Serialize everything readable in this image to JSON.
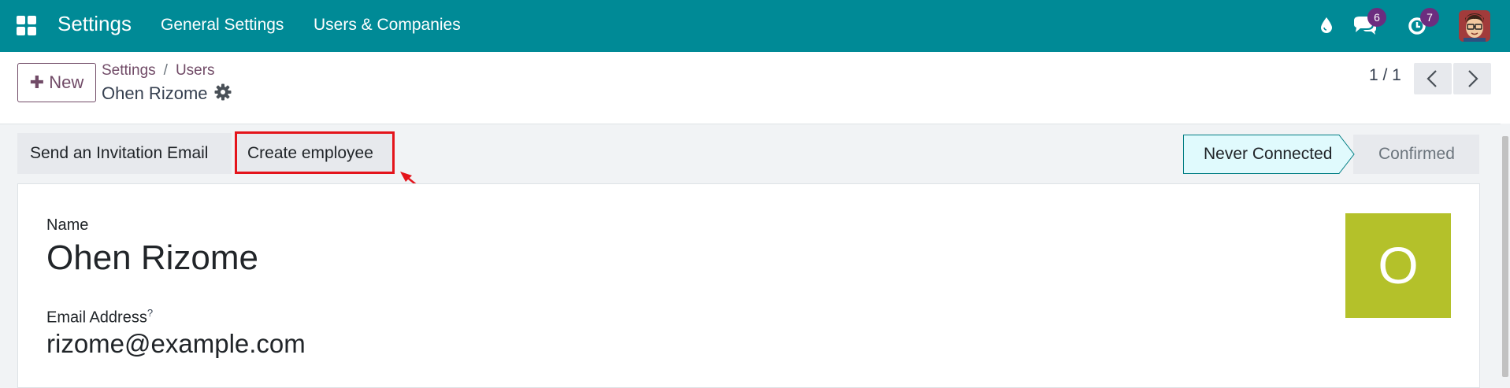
{
  "navbar": {
    "app_title": "Settings",
    "menu": [
      "General Settings",
      "Users & Companies"
    ],
    "icons": {
      "activity": "drop-icon",
      "chat": "chat-icon",
      "clock": "clock-icon"
    },
    "chat_badge": "6",
    "activity_badge": "7",
    "color": "#008a96"
  },
  "control_panel": {
    "new_label": "New",
    "breadcrumb": [
      "Settings",
      "Users"
    ],
    "record_title": "Ohen Rizome",
    "pager": "1 / 1"
  },
  "buttons": {
    "invite": "Send an Invitation Email",
    "create_employee": "Create employee"
  },
  "statusbar": {
    "active": "Never Connected",
    "inactive": "Confirmed"
  },
  "form": {
    "name_label": "Name",
    "name_value": "Ohen Rizome",
    "email_label": "Email Address",
    "email_help": "?",
    "email_value": "rizome@example.com",
    "avatar_letter": "O"
  },
  "colors": {
    "brand": "#714b67",
    "highlight": "#e4141b",
    "status_active_bg": "#e0fafd",
    "avatar_bg": "#b4c12a"
  }
}
